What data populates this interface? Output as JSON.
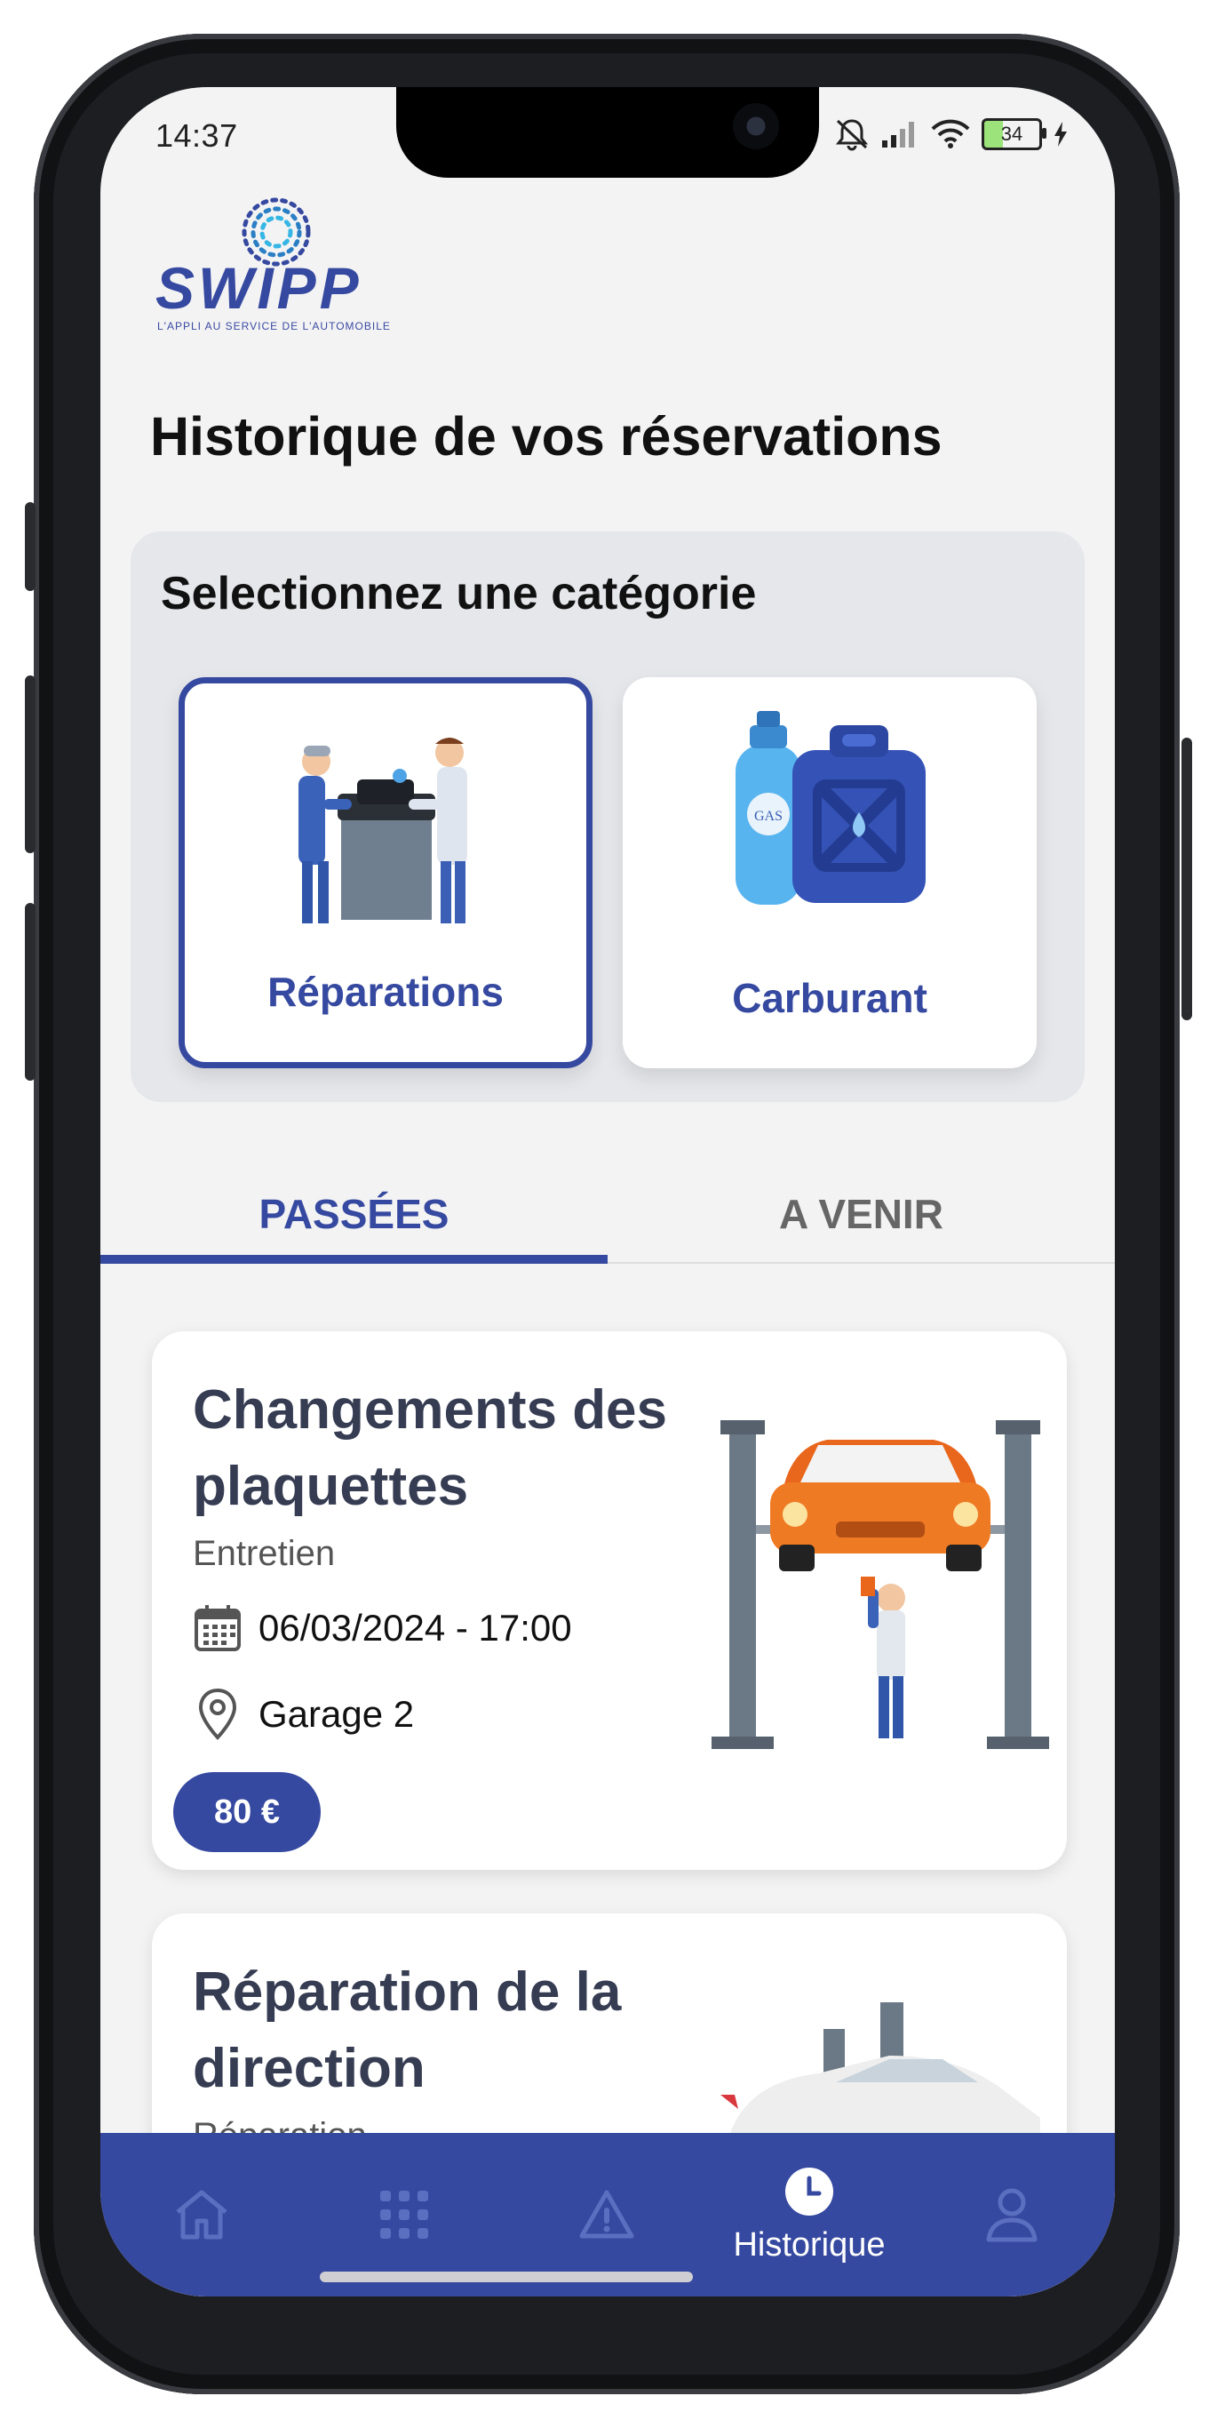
{
  "status_bar": {
    "time": "14:37",
    "battery": "34"
  },
  "logo": {
    "name": "SWIPP",
    "tagline": "L'APPLI AU SERVICE DE L'AUTOMOBILE"
  },
  "page": {
    "title": "Historique de vos réservations"
  },
  "categories": {
    "heading": "Selectionnez une catégorie",
    "items": [
      {
        "label": "Réparations",
        "selected": true,
        "icon": "mechanics-illustration"
      },
      {
        "label": "Carburant",
        "selected": false,
        "icon": "fuel-canister-illustration"
      }
    ]
  },
  "tabs": [
    {
      "label": "PASSÉES",
      "active": true
    },
    {
      "label": "A VENIR",
      "active": false
    }
  ],
  "reservations": [
    {
      "title_line1": "Changements des",
      "title_line2": "plaquettes",
      "type": "Entretien",
      "datetime": "06/03/2024 - 17:00",
      "location": "Garage 2",
      "price": "80 €",
      "icon": "car-lift-mechanic-illustration"
    },
    {
      "title_line1": "Réparation de la",
      "title_line2": "direction",
      "type": "Réparation",
      "icon": "car-on-lift-illustration"
    }
  ],
  "bottom_nav": {
    "items": [
      {
        "icon": "home-icon",
        "label": ""
      },
      {
        "icon": "grid-icon",
        "label": ""
      },
      {
        "icon": "warning-icon",
        "label": ""
      },
      {
        "icon": "clock-icon",
        "label": "Historique",
        "active": true
      },
      {
        "icon": "user-icon",
        "label": ""
      }
    ]
  },
  "colors": {
    "primary": "#3649a0",
    "background": "#f3f3f4",
    "panel": "#e6e7eb",
    "title_text": "#363c52"
  }
}
